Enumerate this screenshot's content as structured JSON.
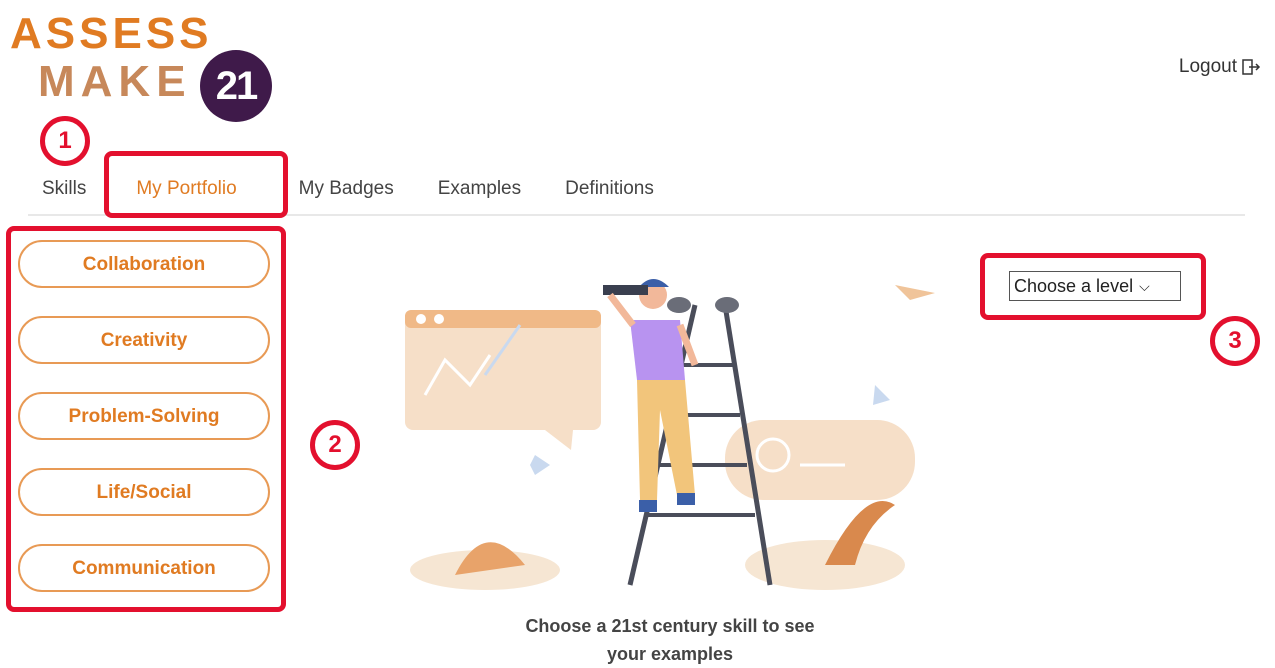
{
  "logo": {
    "line1": "ASSESS",
    "line2": "MAKE",
    "badge": "21"
  },
  "header": {
    "logout_label": "Logout",
    "logout_icon": "logout-icon"
  },
  "tabs": [
    {
      "label": "Skills",
      "active": false
    },
    {
      "label": "My Portfolio",
      "active": true
    },
    {
      "label": "My Badges",
      "active": false
    },
    {
      "label": "Examples",
      "active": false
    },
    {
      "label": "Definitions",
      "active": false
    }
  ],
  "skills": [
    {
      "label": "Collaboration"
    },
    {
      "label": "Creativity"
    },
    {
      "label": "Problem-Solving"
    },
    {
      "label": "Life/Social"
    },
    {
      "label": "Communication"
    }
  ],
  "level_select": {
    "selected": "Choose a level"
  },
  "annotations": {
    "one": "1",
    "two": "2",
    "three": "3"
  },
  "message": {
    "line1": "Choose a 21st century skill to see",
    "line2": "your examples"
  },
  "colors": {
    "accent": "#e07b22",
    "annotation": "#e3102e",
    "badge": "#3f1a4a"
  }
}
